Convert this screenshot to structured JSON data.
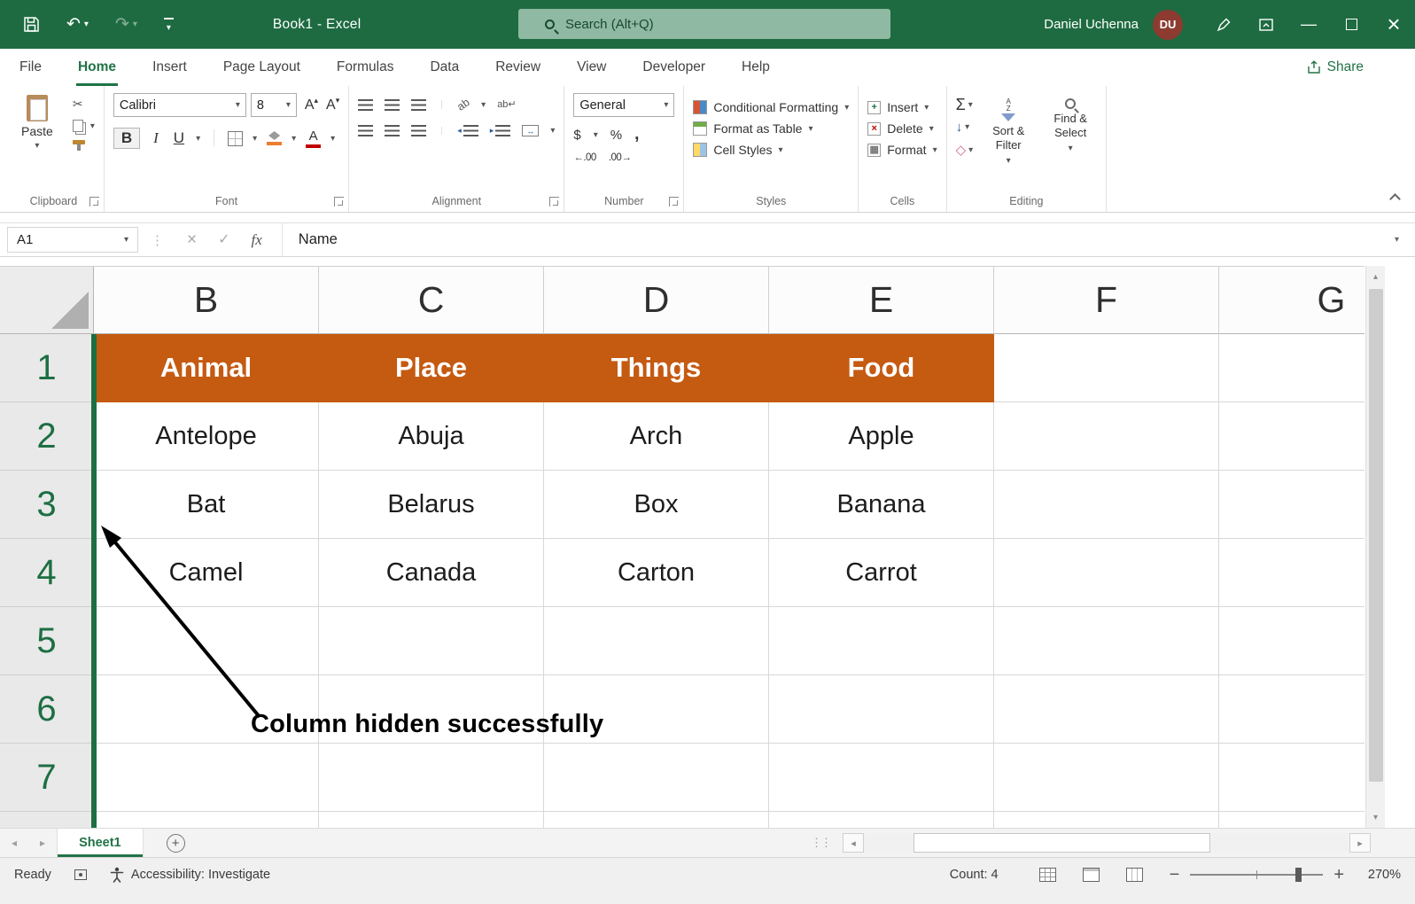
{
  "colors": {
    "title_bar_green": "#1E6B41",
    "accent_green": "#217346",
    "header_orange": "#C55A11",
    "hidden_column_line": "#1D6F42"
  },
  "title_bar": {
    "app_title": "Book1  -  Excel",
    "search_placeholder": "Search (Alt+Q)",
    "user_name": "Daniel Uchenna",
    "avatar_initials": "DU"
  },
  "ribbon_tabs": {
    "items": [
      "File",
      "Home",
      "Insert",
      "Page Layout",
      "Formulas",
      "Data",
      "Review",
      "View",
      "Developer",
      "Help"
    ],
    "active": "Home",
    "share_label": "Share"
  },
  "ribbon": {
    "clipboard": {
      "label": "Clipboard",
      "paste": "Paste"
    },
    "font": {
      "label": "Font",
      "name": "Calibri",
      "size": "8",
      "bold": "B",
      "italic": "I",
      "underline": "U"
    },
    "alignment": {
      "label": "Alignment",
      "wrap_icon_text": "ab↵",
      "orient_icon_text": "ab"
    },
    "number": {
      "label": "Number",
      "format": "General",
      "dollar": "$",
      "percent": "%",
      "comma": ",",
      "dec_increase": "←.00",
      "dec_decrease": ".00→"
    },
    "styles": {
      "label": "Styles",
      "conditional_formatting": "Conditional Formatting",
      "format_as_table": "Format as Table",
      "cell_styles": "Cell Styles"
    },
    "cells": {
      "label": "Cells",
      "insert": "Insert",
      "delete": "Delete",
      "format": "Format"
    },
    "editing": {
      "label": "Editing",
      "autosum": "Σ",
      "sort_filter": "Sort & Filter",
      "find_select": "Find & Select"
    }
  },
  "formula_bar": {
    "name_box": "A1",
    "fx_label": "fx",
    "content": "Name"
  },
  "grid": {
    "visible_columns": [
      "B",
      "C",
      "D",
      "E",
      "F",
      "G"
    ],
    "row_numbers": [
      "1",
      "2",
      "3",
      "4",
      "5",
      "6",
      "7"
    ],
    "header_row": [
      "Animal",
      "Place",
      "Things",
      "Food"
    ],
    "data_rows": [
      [
        "Antelope",
        "Abuja",
        "Arch",
        "Apple"
      ],
      [
        "Bat",
        "Belarus",
        "Box",
        "Banana"
      ],
      [
        "Camel",
        "Canada",
        "Carton",
        "Carrot"
      ]
    ],
    "annotation": "Column hidden successfully"
  },
  "sheet_tabs": {
    "active_sheet": "Sheet1"
  },
  "status_bar": {
    "mode": "Ready",
    "accessibility": "Accessibility: Investigate",
    "count": "Count: 4",
    "zoom": "270%"
  }
}
